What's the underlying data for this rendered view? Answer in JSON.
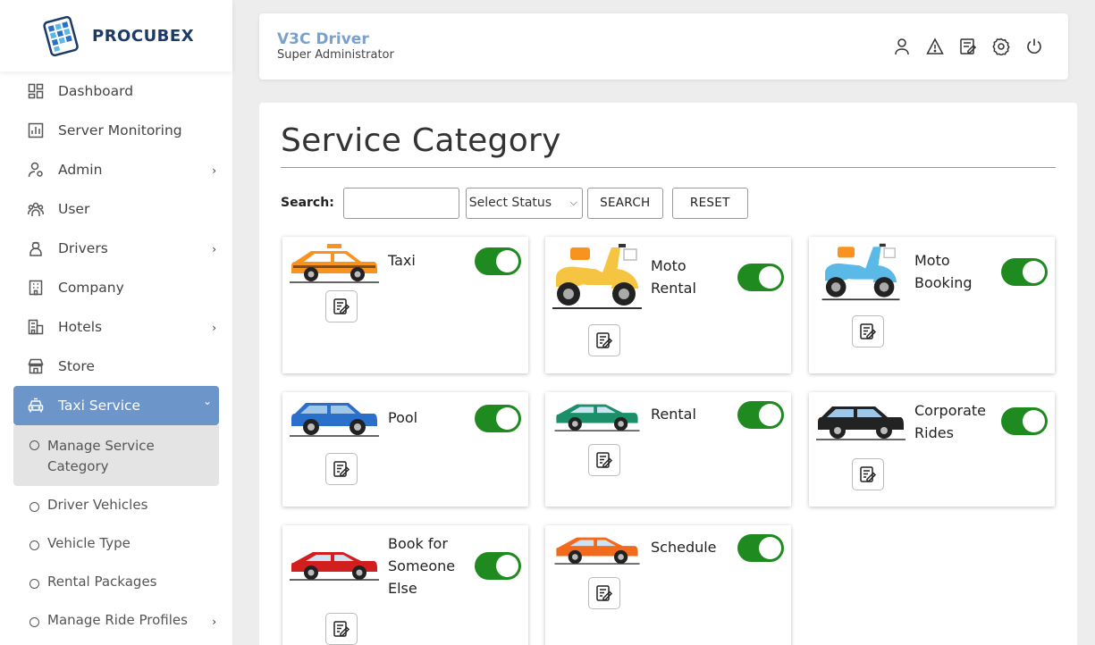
{
  "brand": {
    "name": "PROCUBEX"
  },
  "sidebar": {
    "items": [
      {
        "label": "Dashboard",
        "icon": "dashboard-icon"
      },
      {
        "label": "Server Monitoring",
        "icon": "chart-icon"
      },
      {
        "label": "Admin",
        "icon": "admin-icon",
        "expandable": true
      },
      {
        "label": "User",
        "icon": "users-icon"
      },
      {
        "label": "Drivers",
        "icon": "driver-icon",
        "expandable": true
      },
      {
        "label": "Company",
        "icon": "company-icon"
      },
      {
        "label": "Hotels",
        "icon": "hotel-icon",
        "expandable": true
      },
      {
        "label": "Store",
        "icon": "store-icon"
      },
      {
        "label": "Taxi Service",
        "icon": "taxi-icon",
        "expandable": true,
        "active": true
      }
    ],
    "submenu": [
      {
        "label": "Manage Service Category",
        "current": true
      },
      {
        "label": "Driver Vehicles"
      },
      {
        "label": "Vehicle Type"
      },
      {
        "label": "Rental Packages"
      },
      {
        "label": "Manage Ride Profiles",
        "expandable": true
      }
    ]
  },
  "header": {
    "name": "V3C Driver",
    "role": "Super Administrator",
    "icons": [
      "profile-icon",
      "alert-icon",
      "notes-icon",
      "settings-icon",
      "power-icon"
    ]
  },
  "main": {
    "title": "Service Category",
    "search": {
      "label": "Search:",
      "value": "",
      "status_value": "Select Status",
      "search_label": "SEARCH",
      "reset_label": "RESET"
    },
    "categories": [
      {
        "name": "Taxi",
        "enabled": true,
        "vehicle": "taxi",
        "color": "#f7931e"
      },
      {
        "name": "Moto Rental",
        "enabled": true,
        "vehicle": "scooter",
        "color": "#f5c542"
      },
      {
        "name": "Moto Booking",
        "enabled": true,
        "vehicle": "scooter",
        "color": "#5ab9e6"
      },
      {
        "name": "Pool",
        "enabled": true,
        "vehicle": "suv",
        "color": "#2a6fc9"
      },
      {
        "name": "Rental",
        "enabled": true,
        "vehicle": "sedan",
        "color": "#1a8f6a"
      },
      {
        "name": "Corporate Rides",
        "enabled": true,
        "vehicle": "suv",
        "color": "#222222"
      },
      {
        "name": "Book for Someone Else",
        "enabled": true,
        "vehicle": "sedan",
        "color": "#d11f1f"
      },
      {
        "name": "Schedule",
        "enabled": true,
        "vehicle": "sedan",
        "color": "#f26a1b"
      }
    ]
  },
  "colors": {
    "active_nav": "#6c96c9",
    "toggle_on": "#1f8a1f",
    "accent_name": "#7aa0cc"
  }
}
